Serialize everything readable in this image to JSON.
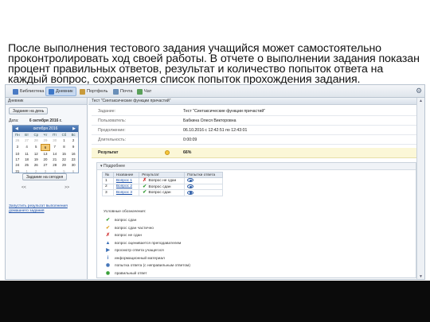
{
  "caption": "После выполнения тестового задания учащийся может самостоятельно проконтролировать ход своей работы. В отчете о выполнении задания показан процент правильных ответов, результат и количество попыток ответа на каждый вопрос, сохраняется список попыток прохождения задания.",
  "toolbar": {
    "items": [
      {
        "label": "Библиотека",
        "color": "#4a7bc4"
      },
      {
        "label": "Дневник",
        "color": "#3e78c8"
      },
      {
        "label": "Портфель",
        "color": "#c89a3a"
      },
      {
        "label": "Почта",
        "color": "#6a8fb8"
      },
      {
        "label": "Чат",
        "color": "#5aa05a"
      }
    ]
  },
  "left": {
    "header": "Дневник",
    "goto_day_button": "Задание на день",
    "date_label": "Дата:",
    "date_value": "6 октября 2016 г.",
    "calendar": {
      "month": "октября 2016",
      "dow": [
        "Пн",
        "Вт",
        "Ср",
        "Чт",
        "Пт",
        "Сб",
        "Вс"
      ],
      "days": [
        "26",
        "27",
        "28",
        "29",
        "30",
        "1",
        "2",
        "3",
        "4",
        "5",
        "6",
        "7",
        "8",
        "9",
        "10",
        "11",
        "12",
        "13",
        "14",
        "15",
        "16",
        "17",
        "18",
        "19",
        "20",
        "21",
        "22",
        "23",
        "24",
        "25",
        "26",
        "27",
        "28",
        "29",
        "30",
        "31",
        "1",
        "2",
        "3",
        "4",
        "5",
        "6"
      ],
      "selected": "6"
    },
    "today_button": "Задание на сегодня",
    "prev_label": "<<",
    "next_label": ">>",
    "link": "Запустить результат выполнения домашнего задания"
  },
  "right": {
    "tab": "Тест \"Синтаксические функции причастий\"",
    "rows": [
      {
        "key": "Задание:",
        "value": "Тест \"Синтаксические функции причастий\""
      },
      {
        "key": "Пользователь:",
        "value": "Бабкина Олеся Викторовна"
      },
      {
        "key": "Продолжение:",
        "value": "06.10.2016 с 12:42:51 по 12:43:01"
      },
      {
        "key": "Длительность:",
        "value": "0:00:09"
      }
    ],
    "result": {
      "key": "Результат",
      "value": "66%"
    },
    "details_label": "Подробнее",
    "table": {
      "headers": [
        "№",
        "Название",
        "Результат",
        "Попытки ответа"
      ],
      "rows": [
        {
          "n": "1",
          "name": "Вопрос 1",
          "mark": "✗",
          "status": "Вопрос не сдан"
        },
        {
          "n": "2",
          "name": "Вопрос 2",
          "mark": "✔",
          "status": "Вопрос сдан"
        },
        {
          "n": "3",
          "name": "Вопрос 3",
          "mark": "✔",
          "status": "Вопрос сдан"
        }
      ]
    },
    "legend_title": "Условные обозначения:",
    "legend": [
      {
        "icon": "check-icon",
        "glyph": "✔",
        "color": "#2e9a2e",
        "label": "вопрос сдан"
      },
      {
        "icon": "partial-check-icon",
        "glyph": "✔",
        "color": "#e0a020",
        "label": "вопрос сдан частично"
      },
      {
        "icon": "cross-icon",
        "glyph": "✗",
        "color": "#d02b2b",
        "label": "вопрос не сдан"
      },
      {
        "icon": "teacher-icon",
        "glyph": "▲",
        "color": "#3c6fb5",
        "label": "вопрос оценивается преподавателем"
      },
      {
        "icon": "view-icon",
        "glyph": "▶",
        "color": "#3c6fb5",
        "label": "просмотр ответа учащегося"
      },
      {
        "icon": "info-icon",
        "glyph": "i",
        "color": "#3c6fb5",
        "label": "информационный материал"
      },
      {
        "icon": "attempt-icon",
        "glyph": "◉",
        "color": "#3c6fb5",
        "label": "попытка ответа (с неправильным ответом)"
      },
      {
        "icon": "correct-attempt-icon",
        "glyph": "◉",
        "color": "#2e9a2e",
        "label": "правильный ответ"
      }
    ]
  }
}
